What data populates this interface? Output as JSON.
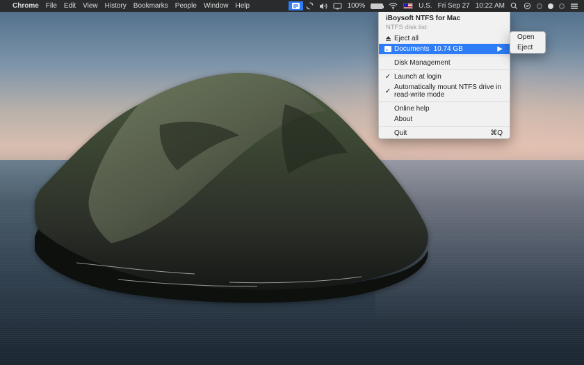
{
  "menubar": {
    "app": "Chrome",
    "items": [
      "File",
      "Edit",
      "View",
      "History",
      "Bookmarks",
      "People",
      "Window",
      "Help"
    ],
    "right": {
      "battery_pct": "100%",
      "input_label": "U.S.",
      "date": "Fri Sep 27",
      "time": "10:22 AM"
    }
  },
  "dropdown": {
    "title": "iBoysoft NTFS for Mac",
    "subtitle": "NTFS disk list:",
    "eject_all": "Eject all",
    "disk_name": "Documents",
    "disk_size": "10.74 GB",
    "disk_mgmt": "Disk Management",
    "launch_login": "Launch at login",
    "auto_mount": "Automatically mount NTFS drive in read-write mode",
    "online_help": "Online help",
    "about": "About",
    "quit": "Quit",
    "quit_shortcut": "⌘Q"
  },
  "submenu": {
    "open": "Open",
    "eject": "Eject"
  }
}
